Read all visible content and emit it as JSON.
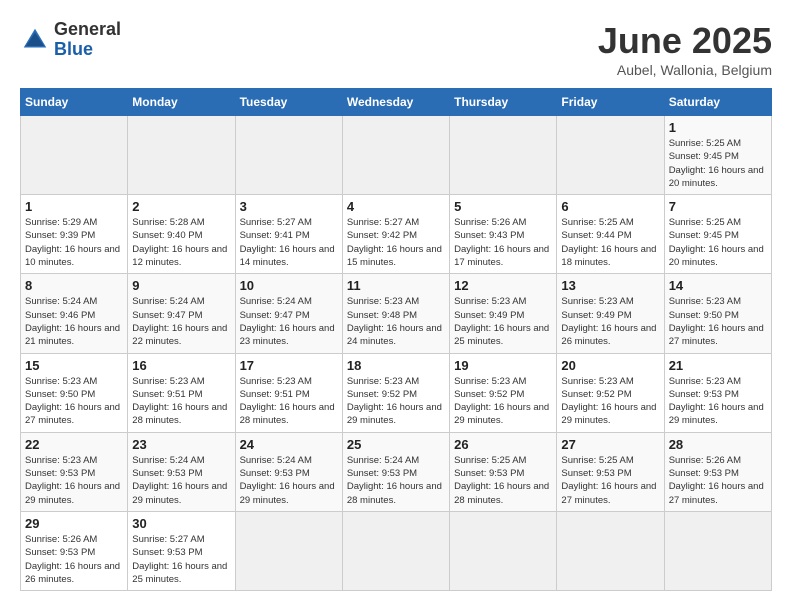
{
  "header": {
    "logo_general": "General",
    "logo_blue": "Blue",
    "title": "June 2025",
    "subtitle": "Aubel, Wallonia, Belgium"
  },
  "calendar": {
    "days_of_week": [
      "Sunday",
      "Monday",
      "Tuesday",
      "Wednesday",
      "Thursday",
      "Friday",
      "Saturday"
    ],
    "weeks": [
      [
        {
          "day": "",
          "empty": true
        },
        {
          "day": "",
          "empty": true
        },
        {
          "day": "",
          "empty": true
        },
        {
          "day": "",
          "empty": true
        },
        {
          "day": "",
          "empty": true
        },
        {
          "day": "",
          "empty": true
        },
        {
          "day": "1",
          "sunrise": "Sunrise: 5:25 AM",
          "sunset": "Sunset: 9:45 PM",
          "daylight": "Daylight: 16 hours and 20 minutes."
        }
      ],
      [
        {
          "day": "1",
          "sunrise": "Sunrise: 5:29 AM",
          "sunset": "Sunset: 9:39 PM",
          "daylight": "Daylight: 16 hours and 10 minutes."
        },
        {
          "day": "2",
          "sunrise": "Sunrise: 5:28 AM",
          "sunset": "Sunset: 9:40 PM",
          "daylight": "Daylight: 16 hours and 12 minutes."
        },
        {
          "day": "3",
          "sunrise": "Sunrise: 5:27 AM",
          "sunset": "Sunset: 9:41 PM",
          "daylight": "Daylight: 16 hours and 14 minutes."
        },
        {
          "day": "4",
          "sunrise": "Sunrise: 5:27 AM",
          "sunset": "Sunset: 9:42 PM",
          "daylight": "Daylight: 16 hours and 15 minutes."
        },
        {
          "day": "5",
          "sunrise": "Sunrise: 5:26 AM",
          "sunset": "Sunset: 9:43 PM",
          "daylight": "Daylight: 16 hours and 17 minutes."
        },
        {
          "day": "6",
          "sunrise": "Sunrise: 5:25 AM",
          "sunset": "Sunset: 9:44 PM",
          "daylight": "Daylight: 16 hours and 18 minutes."
        },
        {
          "day": "7",
          "sunrise": "Sunrise: 5:25 AM",
          "sunset": "Sunset: 9:45 PM",
          "daylight": "Daylight: 16 hours and 20 minutes."
        }
      ],
      [
        {
          "day": "8",
          "sunrise": "Sunrise: 5:24 AM",
          "sunset": "Sunset: 9:46 PM",
          "daylight": "Daylight: 16 hours and 21 minutes."
        },
        {
          "day": "9",
          "sunrise": "Sunrise: 5:24 AM",
          "sunset": "Sunset: 9:47 PM",
          "daylight": "Daylight: 16 hours and 22 minutes."
        },
        {
          "day": "10",
          "sunrise": "Sunrise: 5:24 AM",
          "sunset": "Sunset: 9:47 PM",
          "daylight": "Daylight: 16 hours and 23 minutes."
        },
        {
          "day": "11",
          "sunrise": "Sunrise: 5:23 AM",
          "sunset": "Sunset: 9:48 PM",
          "daylight": "Daylight: 16 hours and 24 minutes."
        },
        {
          "day": "12",
          "sunrise": "Sunrise: 5:23 AM",
          "sunset": "Sunset: 9:49 PM",
          "daylight": "Daylight: 16 hours and 25 minutes."
        },
        {
          "day": "13",
          "sunrise": "Sunrise: 5:23 AM",
          "sunset": "Sunset: 9:49 PM",
          "daylight": "Daylight: 16 hours and 26 minutes."
        },
        {
          "day": "14",
          "sunrise": "Sunrise: 5:23 AM",
          "sunset": "Sunset: 9:50 PM",
          "daylight": "Daylight: 16 hours and 27 minutes."
        }
      ],
      [
        {
          "day": "15",
          "sunrise": "Sunrise: 5:23 AM",
          "sunset": "Sunset: 9:50 PM",
          "daylight": "Daylight: 16 hours and 27 minutes."
        },
        {
          "day": "16",
          "sunrise": "Sunrise: 5:23 AM",
          "sunset": "Sunset: 9:51 PM",
          "daylight": "Daylight: 16 hours and 28 minutes."
        },
        {
          "day": "17",
          "sunrise": "Sunrise: 5:23 AM",
          "sunset": "Sunset: 9:51 PM",
          "daylight": "Daylight: 16 hours and 28 minutes."
        },
        {
          "day": "18",
          "sunrise": "Sunrise: 5:23 AM",
          "sunset": "Sunset: 9:52 PM",
          "daylight": "Daylight: 16 hours and 29 minutes."
        },
        {
          "day": "19",
          "sunrise": "Sunrise: 5:23 AM",
          "sunset": "Sunset: 9:52 PM",
          "daylight": "Daylight: 16 hours and 29 minutes."
        },
        {
          "day": "20",
          "sunrise": "Sunrise: 5:23 AM",
          "sunset": "Sunset: 9:52 PM",
          "daylight": "Daylight: 16 hours and 29 minutes."
        },
        {
          "day": "21",
          "sunrise": "Sunrise: 5:23 AM",
          "sunset": "Sunset: 9:53 PM",
          "daylight": "Daylight: 16 hours and 29 minutes."
        }
      ],
      [
        {
          "day": "22",
          "sunrise": "Sunrise: 5:23 AM",
          "sunset": "Sunset: 9:53 PM",
          "daylight": "Daylight: 16 hours and 29 minutes."
        },
        {
          "day": "23",
          "sunrise": "Sunrise: 5:24 AM",
          "sunset": "Sunset: 9:53 PM",
          "daylight": "Daylight: 16 hours and 29 minutes."
        },
        {
          "day": "24",
          "sunrise": "Sunrise: 5:24 AM",
          "sunset": "Sunset: 9:53 PM",
          "daylight": "Daylight: 16 hours and 29 minutes."
        },
        {
          "day": "25",
          "sunrise": "Sunrise: 5:24 AM",
          "sunset": "Sunset: 9:53 PM",
          "daylight": "Daylight: 16 hours and 28 minutes."
        },
        {
          "day": "26",
          "sunrise": "Sunrise: 5:25 AM",
          "sunset": "Sunset: 9:53 PM",
          "daylight": "Daylight: 16 hours and 28 minutes."
        },
        {
          "day": "27",
          "sunrise": "Sunrise: 5:25 AM",
          "sunset": "Sunset: 9:53 PM",
          "daylight": "Daylight: 16 hours and 27 minutes."
        },
        {
          "day": "28",
          "sunrise": "Sunrise: 5:26 AM",
          "sunset": "Sunset: 9:53 PM",
          "daylight": "Daylight: 16 hours and 27 minutes."
        }
      ],
      [
        {
          "day": "29",
          "sunrise": "Sunrise: 5:26 AM",
          "sunset": "Sunset: 9:53 PM",
          "daylight": "Daylight: 16 hours and 26 minutes."
        },
        {
          "day": "30",
          "sunrise": "Sunrise: 5:27 AM",
          "sunset": "Sunset: 9:53 PM",
          "daylight": "Daylight: 16 hours and 25 minutes."
        },
        {
          "day": "",
          "empty": true
        },
        {
          "day": "",
          "empty": true
        },
        {
          "day": "",
          "empty": true
        },
        {
          "day": "",
          "empty": true
        },
        {
          "day": "",
          "empty": true
        }
      ]
    ]
  }
}
